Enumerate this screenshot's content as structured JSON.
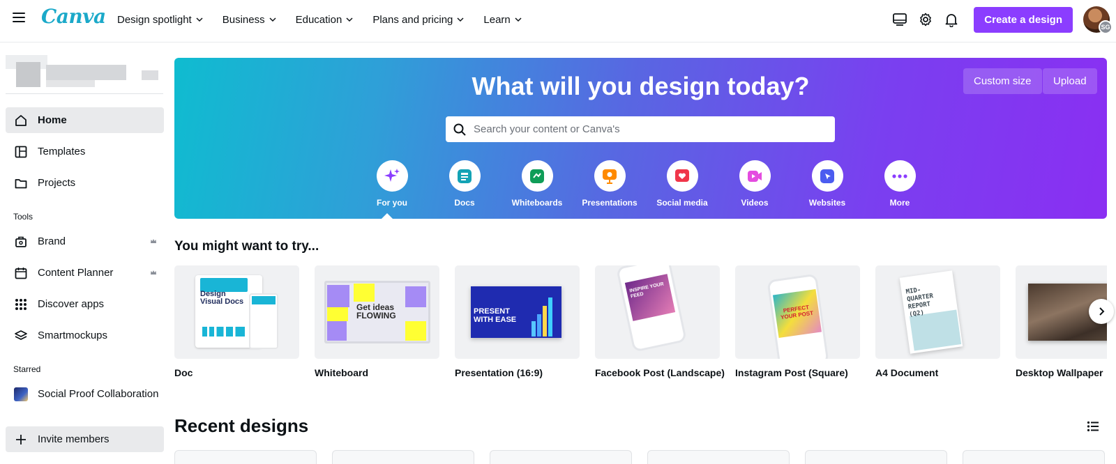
{
  "brand": {
    "logo_text": "Canva",
    "accent": "#8b3dff",
    "logo_color": "#1ba9c9"
  },
  "topnav": {
    "items": [
      {
        "label": "Design spotlight"
      },
      {
        "label": "Business"
      },
      {
        "label": "Education"
      },
      {
        "label": "Plans and pricing"
      },
      {
        "label": "Learn"
      }
    ],
    "icons": [
      "desktop-icon",
      "gear-icon",
      "bell-icon"
    ],
    "create_label": "Create a design",
    "avatar_initials": "SG"
  },
  "sidebar": {
    "main_items": [
      {
        "label": "Home",
        "icon": "home-icon",
        "active": true
      },
      {
        "label": "Templates",
        "icon": "templates-icon"
      },
      {
        "label": "Projects",
        "icon": "folder-icon"
      }
    ],
    "tools_heading": "Tools",
    "tools": [
      {
        "label": "Brand",
        "icon": "brand-icon",
        "crown": true
      },
      {
        "label": "Content Planner",
        "icon": "calendar-icon",
        "crown": true
      },
      {
        "label": "Discover apps",
        "icon": "apps-grid-icon"
      },
      {
        "label": "Smartmockups",
        "icon": "layers-icon"
      }
    ],
    "starred_heading": "Starred",
    "starred": [
      {
        "label": "Social Proof Collaboration"
      }
    ],
    "invite_label": "Invite members"
  },
  "hero": {
    "title": "What will you design today?",
    "custom_size_label": "Custom size",
    "upload_label": "Upload",
    "search_placeholder": "Search your content or Canva's",
    "categories": [
      {
        "label": "For you",
        "icon": "sparkle-icon",
        "color": "#8b3dff"
      },
      {
        "label": "Docs",
        "icon": "doc-icon",
        "color": "#13a3b5"
      },
      {
        "label": "Whiteboards",
        "icon": "whiteboard-icon",
        "color": "#0f9d58"
      },
      {
        "label": "Presentations",
        "icon": "presentation-icon",
        "color": "#ff8a00"
      },
      {
        "label": "Social media",
        "icon": "heart-icon",
        "color": "#f0364a"
      },
      {
        "label": "Videos",
        "icon": "video-icon",
        "color": "#e44ce0"
      },
      {
        "label": "Websites",
        "icon": "cursor-icon",
        "color": "#4b5cf0"
      },
      {
        "label": "More",
        "icon": "more-icon",
        "color": "#8b3dff"
      }
    ]
  },
  "try_section": {
    "title": "You might want to try...",
    "cards": [
      {
        "name": "Doc",
        "thumb_text": "Design Visual Docs"
      },
      {
        "name": "Whiteboard",
        "thumb_text": "Get ideas FLOWING"
      },
      {
        "name": "Presentation (16:9)",
        "thumb_text": "PRESENT WITH EASE"
      },
      {
        "name": "Facebook Post (Landscape)",
        "thumb_text": "INSPIRE YOUR FEED"
      },
      {
        "name": "Instagram Post (Square)",
        "thumb_text": "PERFECT YOUR POST"
      },
      {
        "name": "A4 Document",
        "thumb_text": "MID-QUARTER REPORT (Q2)"
      },
      {
        "name": "Desktop Wallpaper",
        "thumb_text": ""
      }
    ]
  },
  "recent_section": {
    "title": "Recent designs"
  }
}
